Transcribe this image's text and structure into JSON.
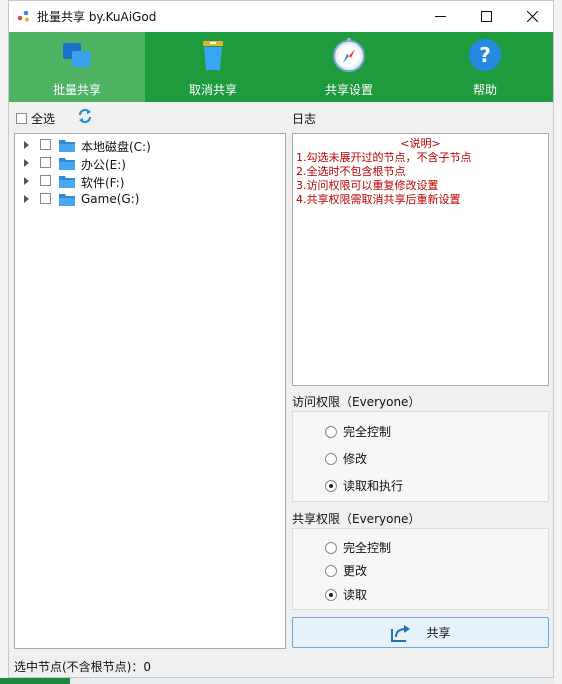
{
  "window": {
    "title": "批量共享 by.KuAiGod"
  },
  "toolbar": {
    "items": [
      {
        "label": "批量共享",
        "icon": "batch-share-icon",
        "active": true
      },
      {
        "label": "取消共享",
        "icon": "trash-icon",
        "active": false
      },
      {
        "label": "共享设置",
        "icon": "compass-icon",
        "active": false
      },
      {
        "label": "帮助",
        "icon": "help-icon",
        "active": false
      }
    ],
    "color": "#1e9b3c",
    "active_color": "#4fb364"
  },
  "tree": {
    "select_all_label": "全选",
    "nodes": [
      {
        "name": "本地磁盘(C:)"
      },
      {
        "name": "办公(E:)"
      },
      {
        "name": "软件(F:)"
      },
      {
        "name": "Game(G:)"
      }
    ]
  },
  "log": {
    "label": "日志",
    "title": "<说明>",
    "lines": [
      "1.勾选未展开过的节点，不含子节点",
      "2.全选时不包含根节点",
      "3.访问权限可以重复修改设置",
      "4.共享权限需取消共享后重新设置"
    ],
    "color": "#c00000"
  },
  "access": {
    "label": "访问权限（Everyone）",
    "options": [
      {
        "label": "完全控制",
        "selected": false
      },
      {
        "label": "修改",
        "selected": false
      },
      {
        "label": "读取和执行",
        "selected": true
      }
    ]
  },
  "share_perm": {
    "label": "共享权限（Everyone）",
    "options": [
      {
        "label": "完全控制",
        "selected": false
      },
      {
        "label": "更改",
        "selected": false
      },
      {
        "label": "读取",
        "selected": true
      }
    ]
  },
  "share_button": {
    "label": "共享"
  },
  "status": {
    "text": "选中节点(不含根节点)：0"
  }
}
